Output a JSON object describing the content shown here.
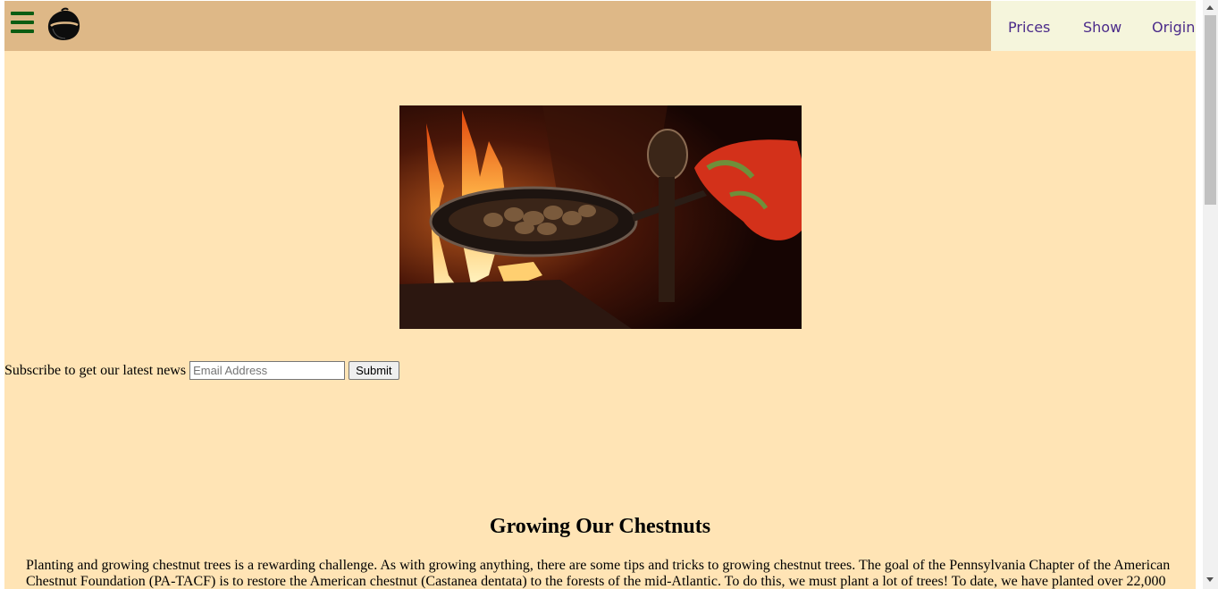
{
  "header": {
    "nav": [
      {
        "label": "Prices"
      },
      {
        "label": "Show"
      },
      {
        "label": "Origin"
      }
    ]
  },
  "hero": {
    "icon": "roasting-chestnuts-image"
  },
  "subscribe": {
    "label": "Subscribe to get our latest news",
    "email_placeholder": "Email Address",
    "submit_label": "Submit"
  },
  "article": {
    "title": "Growing Our Chestnuts",
    "paragraph": "Planting and growing chestnut trees is a rewarding challenge. As with growing anything, there are some tips and tricks to growing chestnut trees. The goal of the Pennsylvania Chapter of the American Chestnut Foundation (PA-TACF) is to restore the American chestnut (Castanea dentata) to the forests of the mid-Atlantic. To do this, we must plant a lot of trees! To date, we have planted over 22,000"
  },
  "colors": {
    "page_background": "#ffe4b5",
    "header_background": "#deb887",
    "nav_background": "#f5f5dc",
    "nav_text": "#4b2b8a",
    "menu_icon": "#0a5c12"
  }
}
